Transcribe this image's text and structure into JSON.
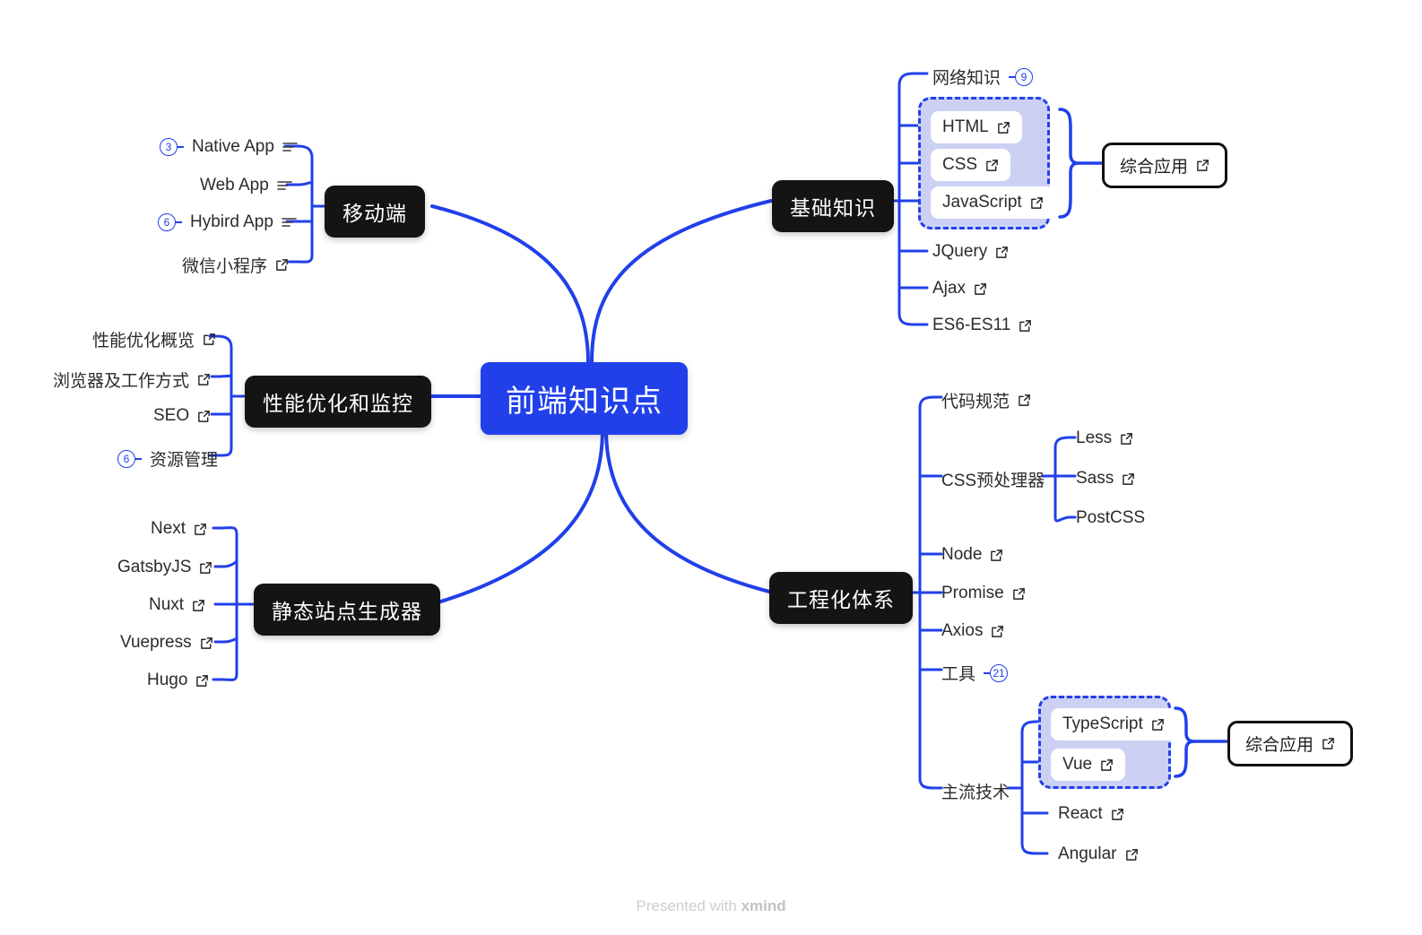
{
  "app": {
    "footer_prefix": "Presented with ",
    "footer_brand": "xmind",
    "accent_blue": "#2140ea",
    "node_black": "#141414",
    "group_fill": "#ccd1f3",
    "text_color": "#2b2b2b"
  },
  "central": {
    "label": "前端知识点"
  },
  "branches": {
    "mobile": {
      "title": "移动端",
      "children": [
        {
          "label": "Native App",
          "badge": "3",
          "icon": "note-icon"
        },
        {
          "label": "Web App",
          "badge": null,
          "icon": "note-icon"
        },
        {
          "label": "Hybird App",
          "badge": "6",
          "icon": "note-icon"
        },
        {
          "label": "微信小程序",
          "badge": null,
          "icon": "link-icon"
        }
      ]
    },
    "performance": {
      "title": "性能优化和监控",
      "children": [
        {
          "label": "性能优化概览",
          "badge": null,
          "icon": "link-icon"
        },
        {
          "label": "浏览器及工作方式",
          "badge": null,
          "icon": "link-icon"
        },
        {
          "label": "SEO",
          "badge": null,
          "icon": "link-icon"
        },
        {
          "label": "资源管理",
          "badge": "6",
          "icon": null
        }
      ]
    },
    "ssg": {
      "title": "静态站点生成器",
      "children": [
        {
          "label": "Next",
          "badge": null,
          "icon": "link-icon"
        },
        {
          "label": "GatsbyJS",
          "badge": null,
          "icon": "link-icon"
        },
        {
          "label": "Nuxt",
          "badge": null,
          "icon": "link-icon"
        },
        {
          "label": "Vuepress",
          "badge": null,
          "icon": "link-icon"
        },
        {
          "label": "Hugo",
          "badge": null,
          "icon": "link-icon"
        }
      ]
    },
    "basics": {
      "title": "基础知识",
      "children": [
        {
          "label": "网络知识",
          "badge": "9",
          "icon": null
        },
        {
          "label": "HTML",
          "badge": null,
          "icon": "link-icon",
          "grouped": true
        },
        {
          "label": "CSS",
          "badge": null,
          "icon": "link-icon",
          "grouped": true
        },
        {
          "label": "JavaScript",
          "badge": null,
          "icon": "link-icon",
          "grouped": true
        },
        {
          "label": "JQuery",
          "badge": null,
          "icon": "link-icon"
        },
        {
          "label": "Ajax",
          "badge": null,
          "icon": "link-icon"
        },
        {
          "label": "ES6-ES11",
          "badge": null,
          "icon": "link-icon"
        }
      ],
      "summary": {
        "label": "综合应用",
        "icon": "link-icon"
      }
    },
    "engineering": {
      "title": "工程化体系",
      "children": [
        {
          "label": "代码规范",
          "badge": null,
          "icon": "link-icon"
        },
        {
          "label": "CSS预处理器",
          "badge": null,
          "icon": null
        },
        {
          "label": "Node",
          "badge": null,
          "icon": "link-icon"
        },
        {
          "label": "Promise",
          "badge": null,
          "icon": "link-icon"
        },
        {
          "label": "Axios",
          "badge": null,
          "icon": "link-icon"
        },
        {
          "label": "工具",
          "badge": "21",
          "icon": null
        },
        {
          "label": "主流技术",
          "badge": null,
          "icon": null
        }
      ],
      "css_preprocessors": [
        {
          "label": "Less",
          "icon": "link-icon"
        },
        {
          "label": "Sass",
          "icon": "link-icon"
        },
        {
          "label": "PostCSS",
          "icon": null
        }
      ],
      "mainstream": [
        {
          "label": "TypeScript",
          "icon": "link-icon",
          "grouped": true
        },
        {
          "label": "Vue",
          "icon": "link-icon",
          "grouped": true
        },
        {
          "label": "React",
          "icon": "link-icon"
        },
        {
          "label": "Angular",
          "icon": "link-icon"
        }
      ],
      "summary": {
        "label": "综合应用",
        "icon": "link-icon"
      }
    }
  }
}
